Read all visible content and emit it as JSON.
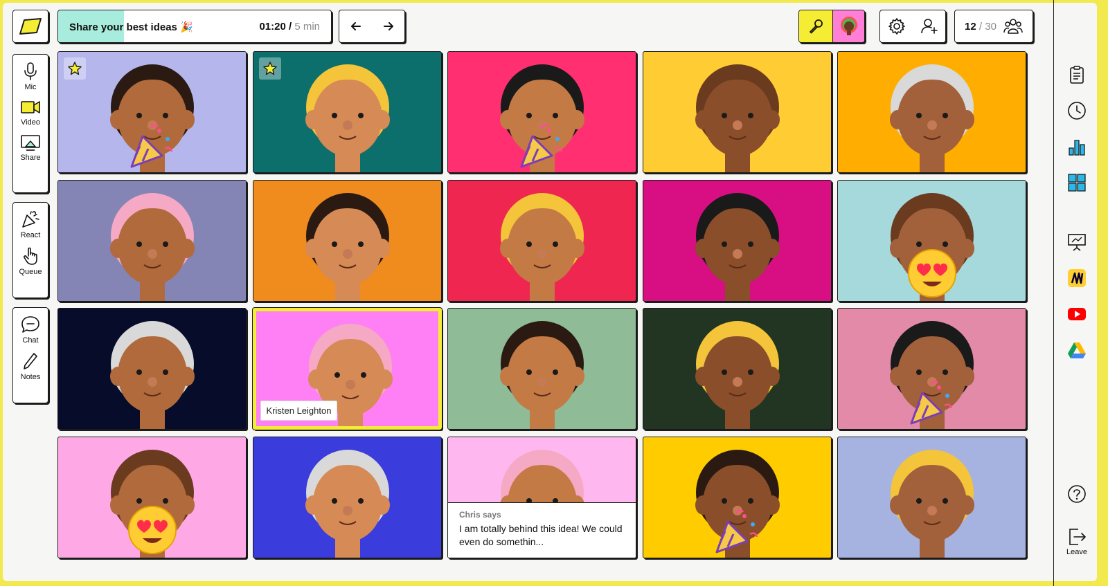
{
  "topic": {
    "title": "Share your best ideas 🎉",
    "elapsed": "01:20 /",
    "total": "5 min",
    "progress": 0.24
  },
  "participants": {
    "current": "12",
    "max": "/ 30"
  },
  "left_tools": [
    {
      "label": "Mic",
      "icon": "mic-icon"
    },
    {
      "label": "Video",
      "icon": "video-icon"
    },
    {
      "label": "Share",
      "icon": "share-screen-icon"
    },
    {
      "label": "React",
      "icon": "party-popper-icon"
    },
    {
      "label": "Queue",
      "icon": "raise-hand-icon"
    },
    {
      "label": "Chat",
      "icon": "chat-icon"
    },
    {
      "label": "Notes",
      "icon": "pencil-icon"
    }
  ],
  "right_tools": {
    "leave_label": "Leave"
  },
  "chat": {
    "sender": "Chris says",
    "message": "I am totally behind this idea! We could even do somethin..."
  },
  "speaker": {
    "name": "Kristen Leighton"
  },
  "colors": {
    "page_bg": "#f2e94e",
    "accent_yellow": "#f5ec34",
    "progress": "#a7ecdc",
    "avatar_pink": "#ff7fd6"
  },
  "tiles": [
    {
      "bg": "#b4b6ec",
      "starred": true,
      "reaction": "party-popper-icon"
    },
    {
      "bg": "#0d6f6c",
      "starred": true
    },
    {
      "bg": "#ff2f72",
      "reaction": "party-popper-icon"
    },
    {
      "bg": "#ffcc33"
    },
    {
      "bg": "#ffad00"
    },
    {
      "bg": "#8585b5"
    },
    {
      "bg": "#f08b1e"
    },
    {
      "bg": "#ee2650"
    },
    {
      "bg": "#d70f83"
    },
    {
      "bg": "#a6d9dc",
      "reaction": "heart-eyes-icon"
    },
    {
      "bg": "#060c29"
    },
    {
      "bg": "#ff7ff4",
      "speaking": true
    },
    {
      "bg": "#8fbb97"
    },
    {
      "bg": "#213522"
    },
    {
      "bg": "#e38aa8",
      "reaction": "party-popper-icon"
    },
    {
      "bg": "#ffa8e6",
      "reaction": "heart-eyes-icon"
    },
    {
      "bg": "#3b3cdc"
    },
    {
      "bg": "#ffb8ef",
      "chat": true
    },
    {
      "bg": "#ffcc00",
      "reaction": "party-popper-icon"
    },
    {
      "bg": "#a6b3e0"
    }
  ]
}
